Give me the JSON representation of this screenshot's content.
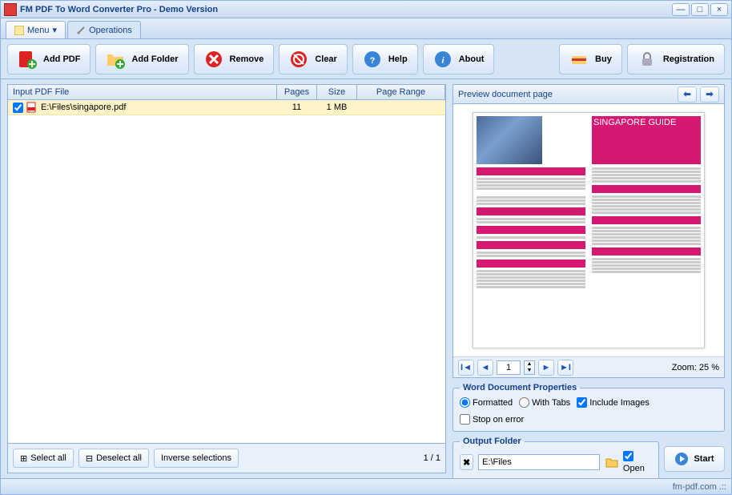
{
  "window": {
    "title": "FM PDF To Word Converter Pro - Demo Version"
  },
  "tabs": {
    "menu": "Menu",
    "operations": "Operations"
  },
  "toolbar": {
    "add_pdf": "Add PDF",
    "add_folder": "Add Folder",
    "remove": "Remove",
    "clear": "Clear",
    "help": "Help",
    "about": "About",
    "buy": "Buy",
    "registration": "Registration"
  },
  "table": {
    "headers": {
      "file": "Input PDF File",
      "pages": "Pages",
      "size": "Size",
      "range": "Page Range"
    },
    "rows": [
      {
        "checked": true,
        "path": "E:\\Files\\singapore.pdf",
        "pages": "11",
        "size": "1 MB",
        "range": ""
      }
    ]
  },
  "selection": {
    "select_all": "Select all",
    "deselect_all": "Deselect all",
    "inverse": "Inverse selections",
    "counter": "1 / 1"
  },
  "preview": {
    "title": "Preview document page",
    "page": "1",
    "zoom_label": "Zoom: 25 %",
    "doc_title": "SINGAPORE GUIDE"
  },
  "props": {
    "legend": "Word Document Properties",
    "formatted": "Formatted",
    "with_tabs": "With Tabs",
    "include_images": "Include Images",
    "stop_on_error": "Stop on error"
  },
  "output": {
    "legend": "Output Folder",
    "path": "E:\\Files",
    "open": "Open",
    "start": "Start"
  },
  "status": {
    "link": "fm-pdf.com .::"
  }
}
